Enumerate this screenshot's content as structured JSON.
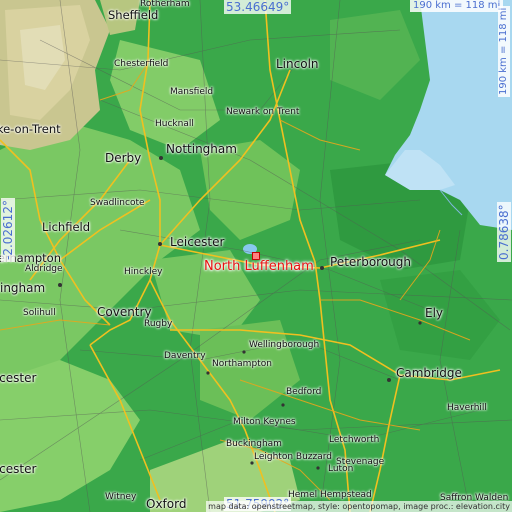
{
  "place": "North Luffenham",
  "coordinates": {
    "top": "53.46649°",
    "bottom": "51.75902°",
    "left": "-2.02612°",
    "right": "0.78638°"
  },
  "scale": {
    "horizontal": "190 km = 118 mi",
    "vertical": "190 km = 118 mi"
  },
  "attribution": "map data: openstreetmap, style: opentopomap, image proc.: elevation.city",
  "cities": {
    "sheffield": "Sheffield",
    "rotherham": "Rotherham",
    "chesterfield": "Chesterfield",
    "mansfield": "Mansfield",
    "lincoln": "Lincoln",
    "hucknall": "Hucknall",
    "newark": "Newark on Trent",
    "stoke": "Stoke-on-Trent",
    "derby": "Derby",
    "nottingham": "Nottingham",
    "swadlincote": "Swadlincote",
    "lichfield": "Lichfield",
    "leicester": "Leicester",
    "peterborough": "Peterborough",
    "wolverhampton": "Wolverhampton",
    "aldridge": "Aldridge",
    "hinckley": "Hinckley",
    "birmingham": "Birmingham",
    "solihull": "Solihull",
    "coventry": "Coventry",
    "rugby": "Rugby",
    "ely": "Ely",
    "daventry": "Daventry",
    "wellingborough": "Wellingborough",
    "northampton": "Northampton",
    "worcester": "Worcester",
    "cambridge": "Cambridge",
    "bedford": "Bedford",
    "haverhill": "Haverhill",
    "milton_keynes": "Milton Keynes",
    "letchworth": "Letchworth",
    "buckingham": "Buckingham",
    "leighton_buzzard": "Leighton Buzzard",
    "stevenage": "Stevenage",
    "luton": "Luton",
    "witney": "Witney",
    "oxford": "Oxford",
    "hemel": "Hemel Hempstead",
    "saffron": "Saffron Walden"
  },
  "colors": {
    "lowland": "#3aa84a",
    "plain": "#8fd470",
    "hills": "#d9d2a0",
    "sea": "#a8d8f0",
    "motorway": "#f0c020",
    "highlight": "#e81010",
    "coordinate_text": "#4a6fd0"
  }
}
